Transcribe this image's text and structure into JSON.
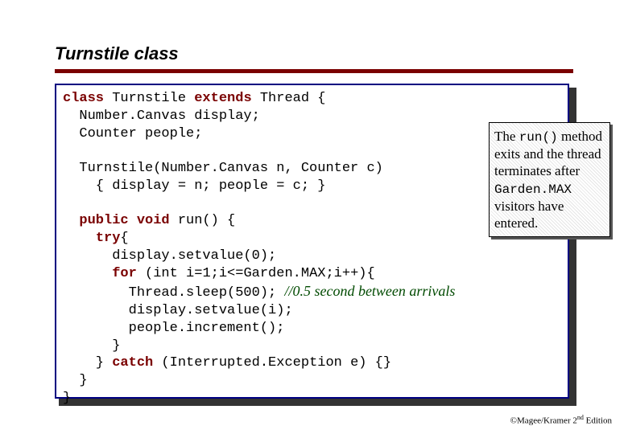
{
  "title": "Turnstile class",
  "code": {
    "l1a": "class",
    "l1b": " Turnstile ",
    "l1c": "extends",
    "l1d": " Thread {",
    "l2": "  Number.Canvas display;",
    "l3": "  Counter people;",
    "l4": "",
    "l5": "  Turnstile(Number.Canvas n, Counter c)",
    "l6": "    { display = n; people = c; }",
    "l7": "",
    "l8a": "  ",
    "l8b": "public void",
    "l8c": " run() {",
    "l9a": "    ",
    "l9b": "try",
    "l9c": "{",
    "l10": "      display.setvalue(0);",
    "l11a": "      ",
    "l11b": "for",
    "l11c": " (int i=1;i<=Garden.MAX;i++){",
    "l12a": "        Thread.sleep(500); ",
    "l12b": "//0.5 second between arrivals",
    "l13": "        display.setvalue(i);",
    "l14": "        people.increment();",
    "l15": "      }",
    "l16a": "    } ",
    "l16b": "catch",
    "l16c": " (Interrupted.Exception e) {}",
    "l17": "  }",
    "l18": "}"
  },
  "callout": {
    "t1": "The ",
    "t2": "run()",
    "t3": " method exits and the thread terminates after ",
    "t4": "Garden.MAX",
    "t5": " visitors have entered."
  },
  "footer": {
    "text1": "©Magee/Kramer ",
    "text2": "2",
    "text3": "nd",
    "text4": " Edition"
  }
}
